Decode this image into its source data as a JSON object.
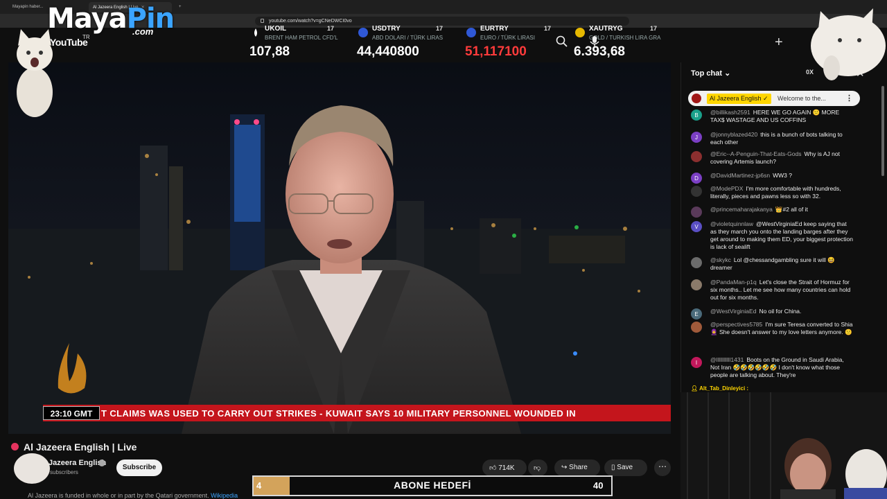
{
  "browser": {
    "tabs": [
      {
        "label": "Mayapin haber..."
      },
      {
        "label": "Al Jazeera English | Live"
      }
    ],
    "url": "youtube.com/watch?v=gCNeDWCI0vo"
  },
  "overlay": {
    "logo_maya": "Maya",
    "logo_pin": "Pin",
    "logo_com": ".com",
    "logo_tr": "TR",
    "youtube_wordmark": "YouTube"
  },
  "ticker": [
    {
      "name": "UKOIL",
      "sub": "BRENT HAM PETROL CFD'L",
      "value": "107,88",
      "color": "#ffffff",
      "flag": "#ffffff"
    },
    {
      "name": "USDTRY",
      "sub": "ABD DOLARI / TÜRK LIRAS",
      "value": "44,440800",
      "color": "#ffffff",
      "flag": "#2f58d6"
    },
    {
      "name": "EURTRY",
      "sub": "EURO / TÜRK LIRASI",
      "value": "51,117100",
      "color": "#ff3b3b",
      "flag": "#2f58d6"
    },
    {
      "name": "XAUTRYG",
      "sub": "GOLD / TURKISH LIRA GRA",
      "value": "6.393,68",
      "color": "#ffffff",
      "flag": "#e6b800"
    }
  ],
  "ticker_badge": "17",
  "video": {
    "clock": "23:10 GMT",
    "headline": "T CLAIMS WAS USED TO CARRY OUT STRIKES   -   KUWAIT SAYS 10 MILITARY PERSONNEL WOUNDED IN"
  },
  "watch": {
    "title": "Al Jazeera English | Live",
    "channel": "Al Jazeera English",
    "subscribers": "subscribers",
    "subscribe_label": "Subscribe",
    "likes": "714K",
    "share_label": "Share",
    "save_label": "Save",
    "funded_text": "Al Jazeera is funded in whole or in part by the Qatari government.",
    "funded_link": "Wikipedia"
  },
  "goal": {
    "label": "ABONE HEDEFİ",
    "current": "4",
    "target": "40",
    "progress": 0.1
  },
  "chat": {
    "header": "Top chat",
    "viewer_count": "0X",
    "pinned": {
      "author": "Al Jazeera English ✓",
      "text": "Welcome to the..."
    },
    "messages": [
      {
        "initial": "B",
        "color": "#1aa08a",
        "author": "@billikash2591",
        "text": "HERE WE GO AGAIN 🙁 MORE TAX$ WASTAGE AND US COFFINS"
      },
      {
        "initial": "J",
        "color": "#7b3fc4",
        "author": "@jonnyblazed420",
        "text": "this is a bunch of bots talking to each other"
      },
      {
        "initial": "",
        "color": "#8b2f2f",
        "author": "@Eric--A-Penguin-That-Eats-Gods",
        "text": "Why is AJ not covering Artemis launch?"
      },
      {
        "initial": "D",
        "color": "#7b3fc4",
        "author": "@DavidMartinez-jp6sn",
        "text": "WW3 ?"
      },
      {
        "initial": "",
        "color": "#333333",
        "author": "@ModePDX",
        "text": "I'm more comfortable with hundreds, literally, pieces and pawns less so with 32."
      },
      {
        "initial": "",
        "color": "#5a3a5a",
        "author": "@princemaharajakanya",
        "text": "👑#2  all of it"
      },
      {
        "initial": "V",
        "color": "#5a4fc4",
        "author": "@violetquinnlaw",
        "text": "@WestVirginiaEd keep saying that as they march you onto the landing barges after they get around to making them ED, your biggest protection is lack of sealift"
      },
      {
        "initial": "",
        "color": "#6b6b6b",
        "author": "@skykc",
        "text": "Lol @chessandgambling sure it will 😆 dreamer"
      },
      {
        "initial": "",
        "color": "#8a7a6a",
        "author": "@PandaMan-p1q",
        "text": "Let's close the Strait of Hormuz for six months.. Let me see how many countries can hold out for six months."
      },
      {
        "initial": "E",
        "color": "#4a6a7a",
        "author": "@WestVirginiaEd",
        "text": "No oil for China."
      },
      {
        "initial": "",
        "color": "#a05a3a",
        "author": "@perspectives5785",
        "text": "I'm sure Teresa converted to Shia 🧕 She doesn't answer to my love letters anymore. 😕"
      },
      {
        "initial": "I",
        "color": "#c2185b",
        "author": "@lllllllllll1431",
        "text": "Boots on the Ground in Saudi Arabia, Not Iran 🤣🤣🤣🤣🤣🤣 I don't know what those people are talking about. They're"
      }
    ],
    "alt_tab": "Alt_Tab_Dinleyici"
  }
}
